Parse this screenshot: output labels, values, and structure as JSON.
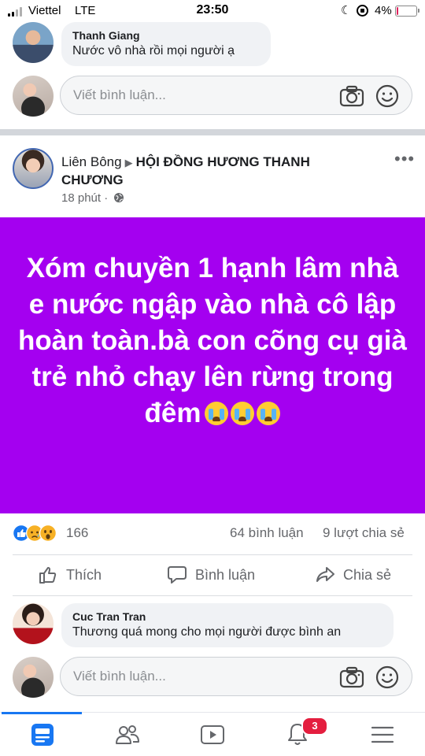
{
  "status_bar": {
    "carrier": "Viettel",
    "network": "LTE",
    "time": "23:50",
    "battery": "4%",
    "battery_level": 0.04
  },
  "comment_top": {
    "author": "Thanh Giang",
    "text": "Nước vô nhà rồi mọi người ạ"
  },
  "comment_input": {
    "placeholder": "Viết bình luận..."
  },
  "post": {
    "author": "Liên Bông",
    "group": "HỘI ĐỒNG HƯƠNG THANH CHƯƠNG",
    "time": "18 phút",
    "audience_icon": "globe-icon",
    "body": "Xóm chuyền 1 hạnh lâm nhà e nước ngập vào nhà cô lập hoàn toàn.bà con cõng cụ già trẻ nhỏ chạy lên rừng trong đêm",
    "body_emojis": [
      "crying-face",
      "crying-face",
      "crying-face"
    ],
    "background_color": "#a400f0",
    "reactions": {
      "icons": [
        "like-reaction-icon",
        "sad-reaction-icon",
        "wow-reaction-icon"
      ],
      "count": "166"
    },
    "comment_count": "64 bình luận",
    "share_count": "9 lượt chia sẻ",
    "actions": {
      "like": "Thích",
      "comment": "Bình luận",
      "share": "Chia sẻ"
    }
  },
  "comment_bottom": {
    "author": "Cuc Tran Tran",
    "text": "Thương quá mong cho mọi người được bình an"
  },
  "bottom_nav": {
    "items": [
      "news-feed-icon",
      "friends-icon",
      "watch-icon",
      "notifications-icon",
      "menu-icon"
    ],
    "notification_badge": "3",
    "active": "news-feed-icon",
    "accent_color": "#1877f2"
  }
}
